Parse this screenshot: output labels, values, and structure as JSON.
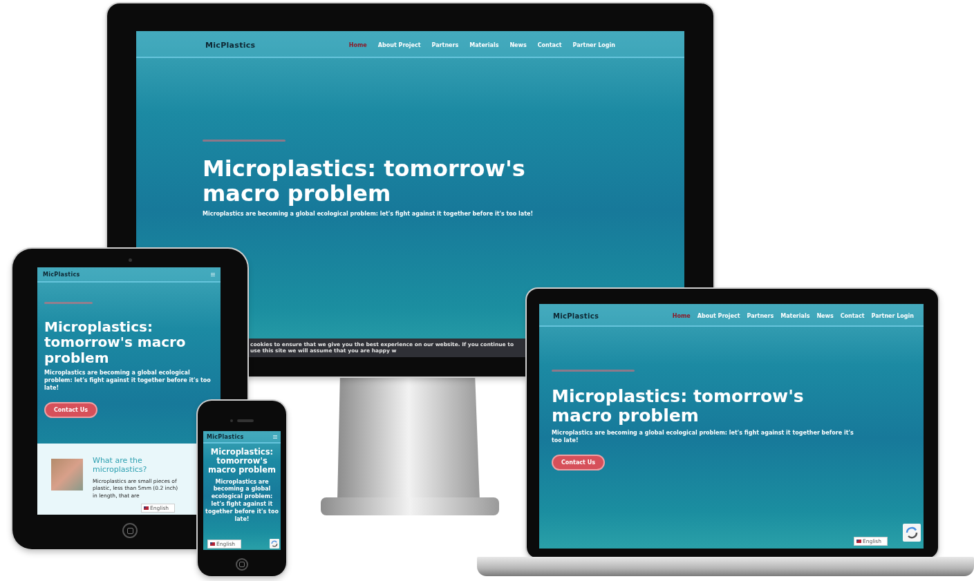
{
  "devices": [
    {
      "kind": "monitor",
      "site": {
        "logo": "MicPlastics",
        "nav": [
          {
            "label": "Home",
            "selected": true
          },
          {
            "label": "About Project",
            "selected": false
          },
          {
            "label": "Partners",
            "selected": false
          },
          {
            "label": "Materials",
            "selected": false
          },
          {
            "label": "News",
            "selected": false
          },
          {
            "label": "Contact",
            "selected": false
          },
          {
            "label": "Partner Login",
            "selected": false
          }
        ],
        "title": "Microplastics: tomorrow's macro problem",
        "subtitle": "Microplastics are becoming a global ecological problem: let's fight against it together before it's too late!",
        "cookie_notice": "cookies to ensure that we give you the best experience on our website. If you continue to use this site we will assume that you are happy w"
      }
    },
    {
      "kind": "laptop",
      "site": {
        "logo": "MicPlastics",
        "nav": [
          {
            "label": "Home",
            "selected": true
          },
          {
            "label": "About Project",
            "selected": false
          },
          {
            "label": "Partners",
            "selected": false
          },
          {
            "label": "Materials",
            "selected": false
          },
          {
            "label": "News",
            "selected": false
          },
          {
            "label": "Contact",
            "selected": false
          },
          {
            "label": "Partner Login",
            "selected": false
          }
        ],
        "title": "Microplastics: tomorrow's macro problem",
        "subtitle": "Microplastics are becoming a global ecological problem: let's fight against it together before it's too late!",
        "button": "Contact Us",
        "language": "English"
      }
    },
    {
      "kind": "tablet",
      "site": {
        "logo": "MicPlastics",
        "title": "Microplastics: tomorrow's macro problem",
        "subtitle": "Microplastics are becoming a global ecological problem: let's fight against it together before it's too late!",
        "button": "Contact Us",
        "about": {
          "heading": "What are the microplastics?",
          "text": "Microplastics are small pieces of plastic, less than 5mm (0.2 inch) in length, that are"
        },
        "language": "English"
      }
    },
    {
      "kind": "phone",
      "site": {
        "logo": "MicPlastics",
        "title": "Microplastics: tomorrow's macro problem",
        "subtitle": "Microplastics are becoming a global ecological problem: let's fight against it together before it's too late!",
        "language": "English"
      }
    }
  ]
}
